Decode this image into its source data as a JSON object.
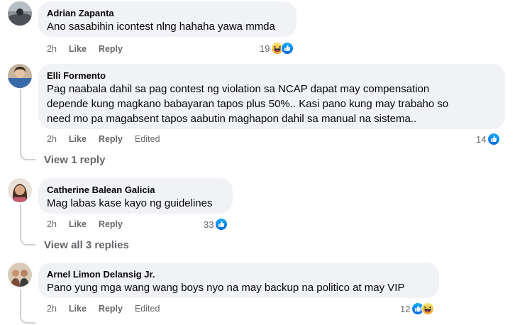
{
  "comments": [
    {
      "author": "Adrian Zapanta",
      "text": "Ano sasabihin icontest nlng hahaha yawa mmda",
      "time": "2h",
      "like_label": "Like",
      "reply_label": "Reply",
      "reaction_count": "19",
      "reactions": [
        "haha-icon",
        "like-icon"
      ]
    },
    {
      "author": "Elli Formento",
      "text": "Pag naabala dahil sa pag contest ng violation sa NCAP dapat may compensation\ndepende kung magkano babayaran tapos plus 50%.. Kasi pano kung may trabaho so\nneed mo pa magabsent tapos aabutin maghapon dahil sa manual na sistema..",
      "time": "2h",
      "like_label": "Like",
      "reply_label": "Reply",
      "edited_label": "Edited",
      "reaction_count": "14",
      "reactions": [
        "like-icon"
      ],
      "view_replies": "View 1 reply"
    },
    {
      "author": "Catherine Balean Galicia",
      "text": "Mag labas kase kayo ng guidelines",
      "time": "2h",
      "like_label": "Like",
      "reply_label": "Reply",
      "reaction_count": "33",
      "reactions": [
        "like-icon"
      ],
      "view_replies": "View all 3 replies"
    },
    {
      "author": "Arnel Limon Delansig Jr.",
      "text": "Pano yung mga wang wang boys nyo na may backup na politico at may VIP",
      "time": "2h",
      "like_label": "Like",
      "reply_label": "Reply",
      "edited_label": "Edited",
      "reaction_count": "12",
      "reactions": [
        "like-icon",
        "haha-icon"
      ]
    }
  ],
  "colors": {
    "bubble_bg": "#f0f2f5",
    "meta_text": "#65676b",
    "like_blue": "#1877f2",
    "haha_yellow": "#f7b125",
    "thread_line": "#ced0d4"
  }
}
